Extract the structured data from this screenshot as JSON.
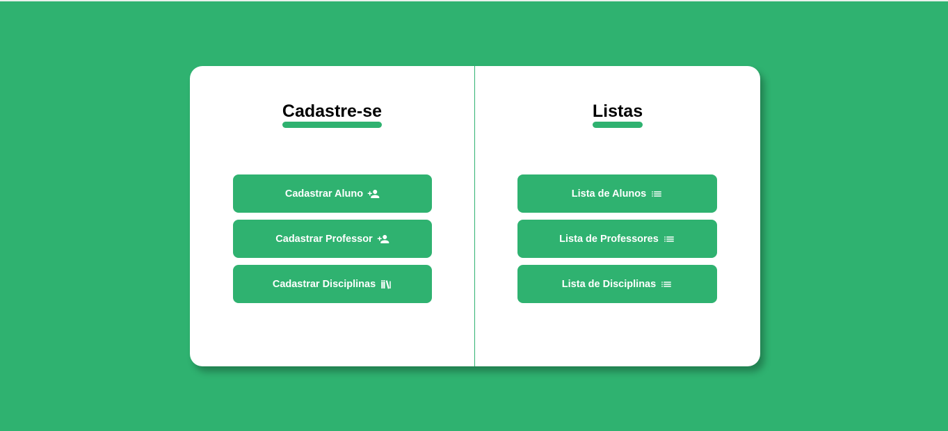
{
  "register_panel": {
    "title": "Cadastre-se",
    "buttons": [
      {
        "label": "Cadastrar Aluno",
        "icon": "person-add-icon"
      },
      {
        "label": "Cadastrar Professor",
        "icon": "person-add-icon"
      },
      {
        "label": "Cadastrar Disciplinas",
        "icon": "library-books-icon"
      }
    ]
  },
  "lists_panel": {
    "title": "Listas",
    "buttons": [
      {
        "label": "Lista de Alunos",
        "icon": "list-icon"
      },
      {
        "label": "Lista de Professores",
        "icon": "list-icon"
      },
      {
        "label": "Lista de Disciplinas",
        "icon": "list-icon"
      }
    ]
  },
  "colors": {
    "background": "#2fb270",
    "accent": "#2fb270",
    "card": "#ffffff",
    "button_text": "#ffffff",
    "title_text": "#000000"
  }
}
